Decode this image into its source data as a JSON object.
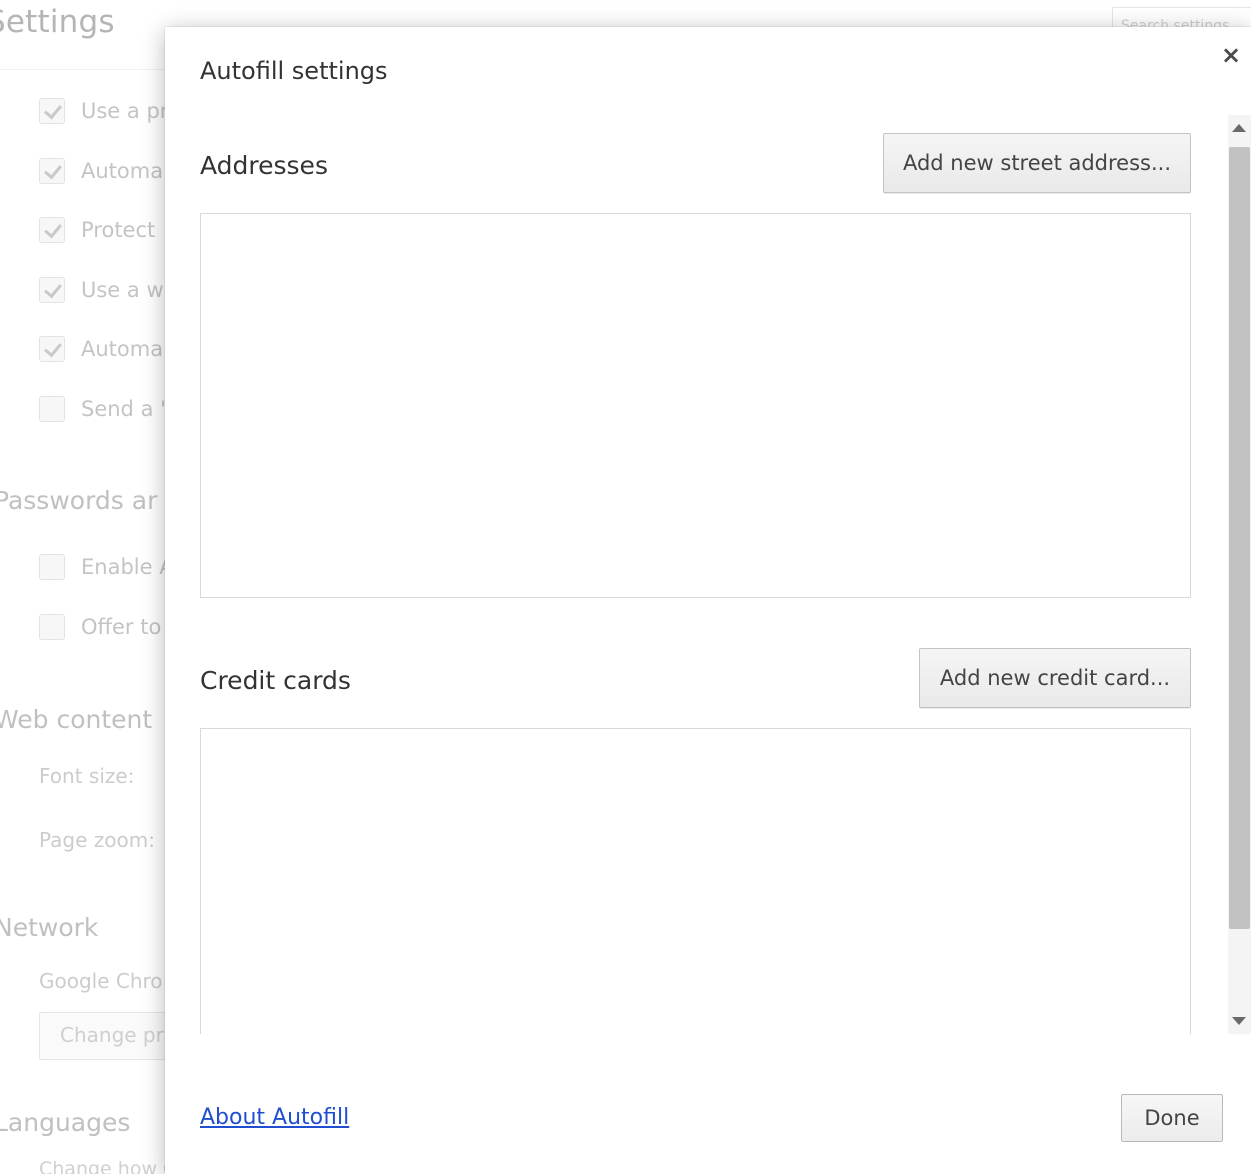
{
  "background": {
    "title": "Settings",
    "search_placeholder": "Search settings",
    "checkbox_rows": [
      {
        "label": "Use a pr",
        "checked": true
      },
      {
        "label": "Automa",
        "checked": true
      },
      {
        "label": "Protect",
        "checked": true
      },
      {
        "label": "Use a w",
        "checked": true
      },
      {
        "label": "Automa",
        "checked": true
      },
      {
        "label": "Send a \"",
        "checked": false
      }
    ],
    "passwords_section": "Passwords ar",
    "password_rows": [
      {
        "label": "Enable A",
        "checked": false
      },
      {
        "label": "Offer to",
        "checked": false
      }
    ],
    "web_content_section": "Web content",
    "font_size_label": "Font size:",
    "page_zoom_label": "Page zoom:",
    "network_section": "Network",
    "network_text": "Google Chro",
    "change_proxy_button": "Change pr",
    "languages_section": "Languages",
    "languages_text": "Change how Google Chrome handles and displays languages. Learn more"
  },
  "dialog": {
    "title": "Autofill settings",
    "close_symbol": "×",
    "addresses": {
      "title": "Addresses",
      "add_button": "Add new street address..."
    },
    "credit_cards": {
      "title": "Credit cards",
      "add_button": "Add new credit card..."
    },
    "about_link": "About Autofill",
    "done_button": "Done"
  },
  "colors": {
    "link": "#1f4fcf",
    "scroll_thumb": "#c2c2c2"
  }
}
